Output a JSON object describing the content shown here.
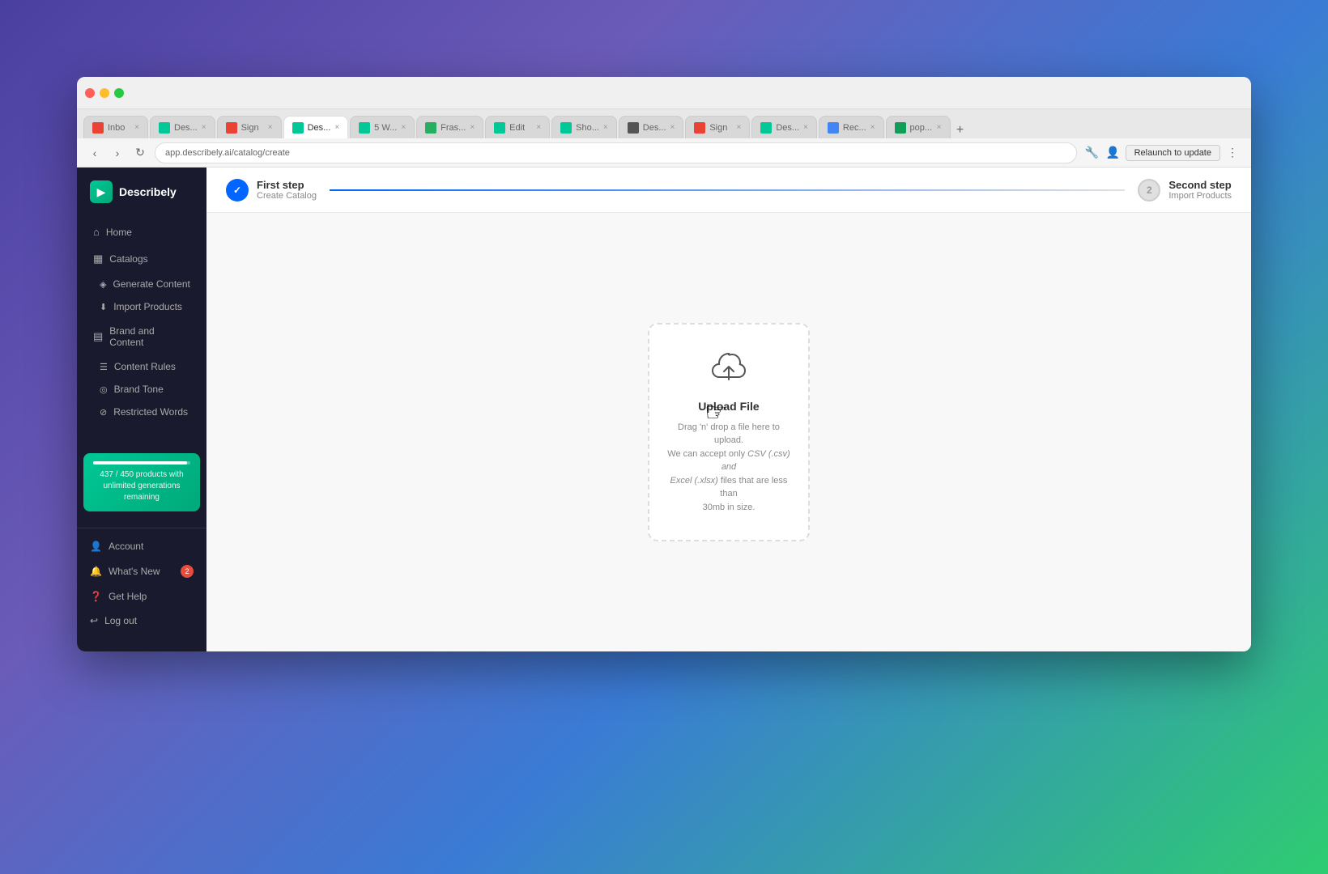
{
  "browser": {
    "url": "app.describely.ai/catalog/create",
    "relaunch_label": "Relaunch to update",
    "tabs": [
      {
        "label": "Inbo",
        "color": "#EA4335",
        "active": false
      },
      {
        "label": "Des...",
        "color": "#00c896",
        "active": false
      },
      {
        "label": "Sign",
        "color": "#EA4335",
        "active": false
      },
      {
        "label": "Des...",
        "color": "#00c896",
        "active": true
      },
      {
        "label": "5 W...",
        "color": "#00c896",
        "active": false
      },
      {
        "label": "Fras...",
        "color": "#27ae60",
        "active": false
      },
      {
        "label": "Edit",
        "color": "#00c896",
        "active": false
      },
      {
        "label": "Sho...",
        "color": "#00c896",
        "active": false
      },
      {
        "label": "Des...",
        "color": "#333",
        "active": false
      },
      {
        "label": "Sign",
        "color": "#EA4335",
        "active": false
      },
      {
        "label": "Des...",
        "color": "#00c896",
        "active": false
      },
      {
        "label": "Rec...",
        "color": "#4285F4",
        "active": false
      },
      {
        "label": "pop...",
        "color": "#0f9d58",
        "active": false
      }
    ]
  },
  "sidebar": {
    "logo": "Describely",
    "nav": {
      "home_label": "Home",
      "catalogs_label": "Catalogs",
      "generate_content_label": "Generate Content",
      "import_products_label": "Import Products",
      "brand_and_content_label": "Brand and Content",
      "content_rules_label": "Content Rules",
      "brand_tone_label": "Brand Tone",
      "restricted_words_label": "Restricted Words"
    },
    "progress": {
      "used": "437",
      "total": "450",
      "label": "437 / 450 products with unlimited generations remaining",
      "percent": 97
    },
    "bottom": {
      "account_label": "Account",
      "whats_new_label": "What's New",
      "whats_new_badge": "2",
      "get_help_label": "Get Help",
      "log_out_label": "Log out"
    }
  },
  "stepper": {
    "step1_title": "First step",
    "step1_subtitle": "Create Catalog",
    "step2_num": "2",
    "step2_title": "Second step",
    "step2_subtitle": "Import Products"
  },
  "upload": {
    "title": "Upload File",
    "desc_line1": "Drag 'n' drop a file here to upload.",
    "desc_line2": "We can accept only",
    "desc_csv": "CSV (.csv) and",
    "desc_excel": "Excel (.xlsx)",
    "desc_line3": "files that are less than",
    "desc_line4": "30mb in size."
  }
}
